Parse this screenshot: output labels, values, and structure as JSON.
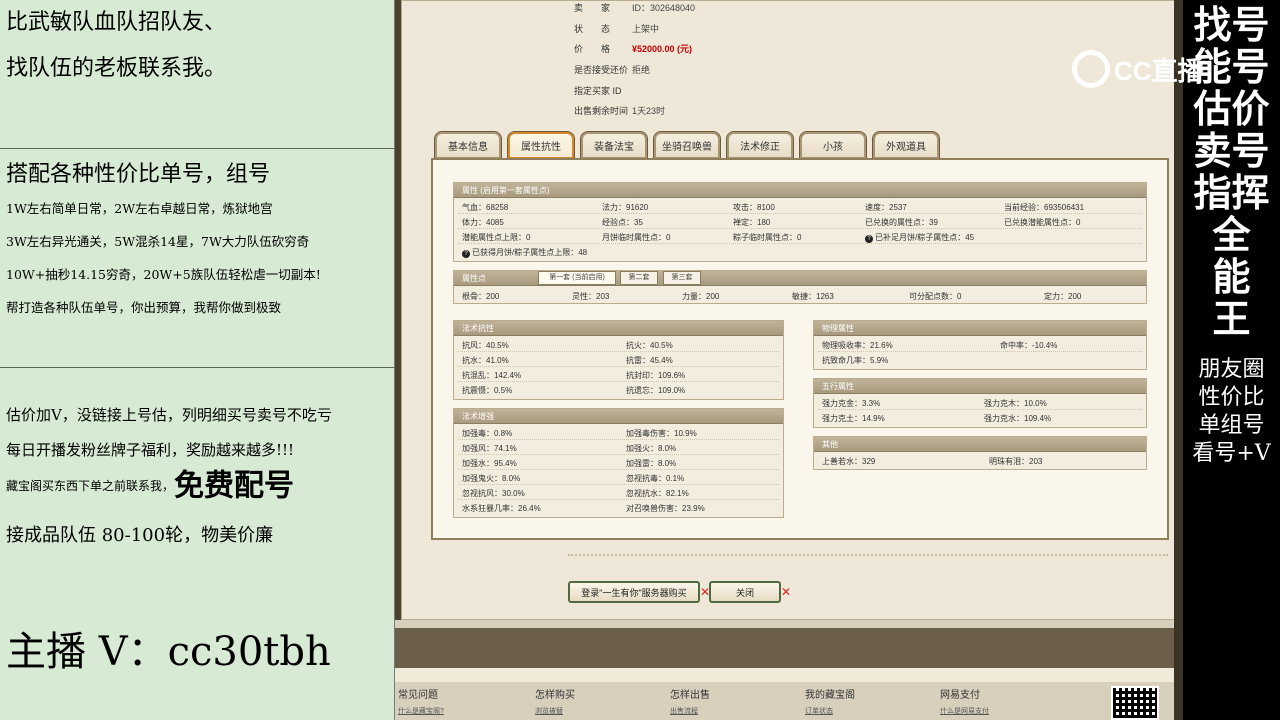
{
  "left": {
    "line1": "比武敏队血队招队友、",
    "line2": "找队伍的老板联系我。",
    "line3": "搭配各种性价比单号，组号",
    "line4": "1W左右简单日常，2W左右卓越日常，炼狱地宫",
    "line5": "3W左右异光通关，5W混杀14星，7W大力队伍砍穷奇",
    "line6": "10W+抽秒14.15穷奇，20W+5族队伍轻松虐一切副本!",
    "line7": "帮打造各种队伍单号，你出预算，我帮你做到极致",
    "line8": "估价加V，没链接上号估，列明细买号卖号不吃亏",
    "line9": "每日开播发粉丝牌子福利，奖励越来越多!!!",
    "line10a": "藏宝阁买东西下单之前联系我，",
    "line10b": "免费配号",
    "line11": "接成品队伍 80-100轮，物美价廉",
    "line12": "主播 V：cc30tbh"
  },
  "right": {
    "vertical_big": [
      "找号",
      "能号",
      "估价",
      "卖号",
      "指挥",
      "全",
      "能",
      "王"
    ],
    "vertical_small": [
      "朋友圈",
      "性价比",
      "单组号",
      "看号+V"
    ],
    "logo_text": "CC直播"
  },
  "info": {
    "seller_label": "卖　　家",
    "seller_value": "ID：302648040",
    "status_label": "状　　态",
    "status_value": "上架中",
    "price_label": "价　　格",
    "price_value": "¥52000.00 (元)",
    "bargain_label": "是否接受还价",
    "bargain_value": "拒绝",
    "buyer_label": "指定买家 ID",
    "buyer_value": "",
    "remain_label": "出售剩余时间",
    "remain_value": "1天23时"
  },
  "tabs": [
    "基本信息",
    "属性抗性",
    "装备法宝",
    "坐骑召唤兽",
    "法术修正",
    "小孩",
    "外观道具"
  ],
  "attributes": {
    "title": "属性 (启用第一套属性点)",
    "rows": [
      [
        "气血：68258",
        "法力：91620",
        "攻击：8100",
        "速度：2537",
        "当前经验：693506431"
      ],
      [
        "体力：4085",
        "经验点：35",
        "禅定：180",
        "已兑换的属性点：39",
        "已兑换潜能属性点：0"
      ],
      [
        "潜能属性点上限：0",
        "月饼临时属性点：0",
        "粽子临时属性点：0",
        "已补足月饼/粽子属性点：45",
        ""
      ]
    ],
    "note": "已获得月饼/粽子属性点上限：48"
  },
  "points": {
    "title": "属性点",
    "subtabs": [
      "第一套 (当前启用)",
      "第二套",
      "第三套"
    ],
    "values": [
      "根骨：200",
      "灵性：203",
      "力量：200",
      "敏捷：1263",
      "可分配点数：0",
      "定力：200"
    ]
  },
  "resist": {
    "title": "法术抗性",
    "rows": [
      [
        "抗风：40.5%",
        "抗火：40.5%"
      ],
      [
        "抗水：41.0%",
        "抗雷：45.4%"
      ],
      [
        "抗混乱：142.4%",
        "抗封印：109.6%"
      ],
      [
        "抗震慑：0.5%",
        "抗遗忘：109.0%"
      ]
    ]
  },
  "enhance": {
    "title": "法术增强",
    "rows": [
      [
        "加强毒：0.8%",
        "加强毒伤害：10.9%"
      ],
      [
        "加强风：74.1%",
        "加强火：8.0%"
      ],
      [
        "加强水：95.4%",
        "加强雷：8.0%"
      ],
      [
        "加强鬼火：8.0%",
        "忽视抗毒：0.1%"
      ],
      [
        "忽视抗风：30.0%",
        "忽视抗水：82.1%"
      ],
      [
        "水系狂暴几率：26.4%",
        "对召唤兽伤害：23.9%"
      ]
    ]
  },
  "physical": {
    "title": "物理属性",
    "rows": [
      [
        "物理吸收率：21.6%",
        "命中率：-10.4%"
      ],
      [
        "抗致命几率：5.9%",
        ""
      ]
    ]
  },
  "five": {
    "title": "五行属性",
    "rows": [
      [
        "强力克金：3.3%",
        "强力克木：10.0%"
      ],
      [
        "强力克土：14.9%",
        "强力克水：109.4%"
      ]
    ]
  },
  "other": {
    "title": "其他",
    "rows": [
      [
        "上善若水：329",
        "明珠有泪：203"
      ]
    ]
  },
  "buttons": {
    "login_label": "登录\"一生有你\"服务器购买",
    "close_label": "关闭"
  },
  "footer": {
    "cols": [
      "常见问题",
      "怎样购买",
      "怎样出售",
      "我的藏宝阁",
      "网易支付"
    ],
    "links": [
      "什么是藏宝阁?",
      "浏览被替",
      "出售流程",
      "订单状态",
      "什么是网易支付"
    ]
  }
}
